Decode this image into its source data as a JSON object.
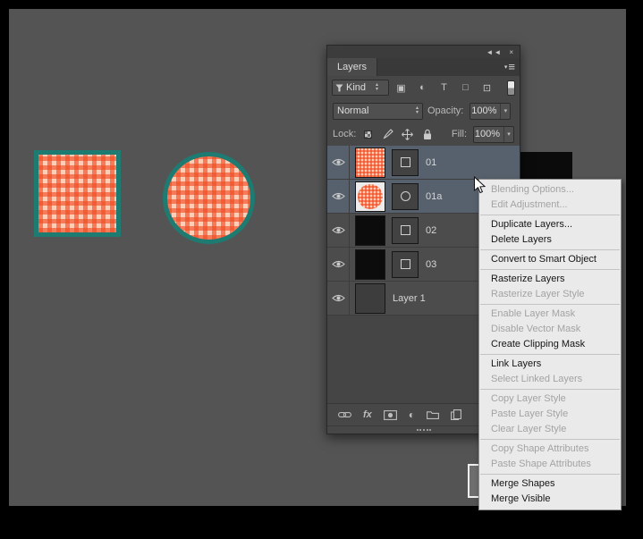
{
  "window": {
    "collapse_icon": "◄◄",
    "close_icon": "×"
  },
  "icons": {
    "panel_menu": "≡",
    "panel_menu_down": "▾",
    "spinner_up": "▴",
    "spinner_down": "▾",
    "dropdown_arrow": "▾",
    "adjustment_glyph": "◐"
  },
  "panel": {
    "tab_label": "Layers",
    "filter_row": {
      "kind_label": "Kind",
      "filter_icons": [
        {
          "name": "filter-pixel-layers-icon",
          "glyph": "▣"
        },
        {
          "name": "filter-adjustment-layers-icon",
          "glyph": "◐"
        },
        {
          "name": "filter-type-layers-icon",
          "glyph": "T"
        },
        {
          "name": "filter-shape-layers-icon",
          "glyph": "□"
        },
        {
          "name": "filter-smart-objects-icon",
          "glyph": "⊡"
        }
      ]
    },
    "blend_row": {
      "blend_mode": "Normal",
      "opacity_label": "Opacity:",
      "opacity_value": "100%"
    },
    "lock_row": {
      "lock_label": "Lock:",
      "fill_label": "Fill:",
      "fill_value": "100%"
    },
    "layers": [
      {
        "name": "01",
        "selected": true,
        "visible": true,
        "thumb": "pattern-square",
        "mask": "square"
      },
      {
        "name": "01a",
        "selected": true,
        "visible": true,
        "thumb": "pattern-circle",
        "mask": "circle"
      },
      {
        "name": "02",
        "selected": false,
        "visible": true,
        "thumb": "black",
        "mask": "square"
      },
      {
        "name": "03",
        "selected": false,
        "visible": true,
        "thumb": "black",
        "mask": "square"
      },
      {
        "name": "Layer 1",
        "selected": false,
        "visible": true,
        "thumb": "dark",
        "mask": null
      }
    ],
    "fx_label": "fx"
  },
  "context_menu": {
    "items": [
      {
        "label": "Blending Options...",
        "enabled": false
      },
      {
        "label": "Edit Adjustment...",
        "enabled": false
      },
      {
        "separator": true
      },
      {
        "label": "Duplicate Layers...",
        "enabled": true
      },
      {
        "label": "Delete Layers",
        "enabled": true
      },
      {
        "separator": true
      },
      {
        "label": "Convert to Smart Object",
        "enabled": true
      },
      {
        "separator": true
      },
      {
        "label": "Rasterize Layers",
        "enabled": true
      },
      {
        "label": "Rasterize Layer Style",
        "enabled": false
      },
      {
        "separator": true
      },
      {
        "label": "Enable Layer Mask",
        "enabled": false
      },
      {
        "label": "Disable Vector Mask",
        "enabled": false
      },
      {
        "label": "Create Clipping Mask",
        "enabled": true
      },
      {
        "separator": true
      },
      {
        "label": "Link Layers",
        "enabled": true
      },
      {
        "label": "Select Linked Layers",
        "enabled": false
      },
      {
        "separator": true
      },
      {
        "label": "Copy Layer Style",
        "enabled": false
      },
      {
        "label": "Paste Layer Style",
        "enabled": false
      },
      {
        "label": "Clear Layer Style",
        "enabled": false
      },
      {
        "separator": true
      },
      {
        "label": "Copy Shape Attributes",
        "enabled": false
      },
      {
        "label": "Paste Shape Attributes",
        "enabled": false
      },
      {
        "separator": true
      },
      {
        "label": "Merge Shapes",
        "enabled": true
      },
      {
        "label": "Merge Visible",
        "enabled": true
      }
    ]
  },
  "colors": {
    "workspace_bg": "#545454",
    "panel_bg": "#474747",
    "selection_row": "#57616d",
    "pattern_orange": "#f0481e",
    "pattern_light": "#ffcdb5",
    "teal_stroke": "#1d7b71",
    "menu_bg": "#eaeaea",
    "menu_disabled_text": "#a3a3a3"
  }
}
